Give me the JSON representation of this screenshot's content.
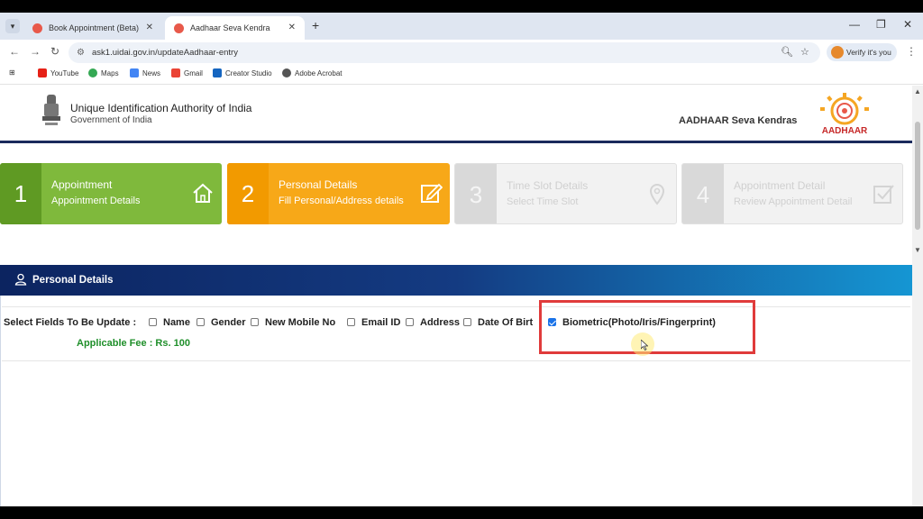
{
  "browser": {
    "tabs": [
      {
        "title": "Book Appointment (Beta)",
        "active": false
      },
      {
        "title": "Aadhaar Seva Kendra",
        "active": true
      }
    ],
    "url": "ask1.uidai.gov.in/updateAadhaar-entry",
    "profile_label": "Verify it's you",
    "bookmarks": [
      "YouTube",
      "Maps",
      "News",
      "Gmail",
      "Creator Studio",
      "Adobe Acrobat"
    ]
  },
  "header": {
    "org_name": "Unique Identification Authority of India",
    "org_sub": "Government of India",
    "seva_title": "AADHAAR Seva Kendras",
    "logo_text": "AADHAAR"
  },
  "steps": [
    {
      "num": "1",
      "title": "Appointment",
      "subtitle": "Appointment Details",
      "icon": "home-icon",
      "state": "done"
    },
    {
      "num": "2",
      "title": "Personal Details",
      "subtitle": "Fill Personal/Address details",
      "icon": "edit-icon",
      "state": "current"
    },
    {
      "num": "3",
      "title": "Time Slot Details",
      "subtitle": "Select Time Slot",
      "icon": "location-pin-icon",
      "state": "disabled"
    },
    {
      "num": "4",
      "title": "Appointment Detail",
      "subtitle": "Review Appointment Detail",
      "icon": "checkbox-icon",
      "state": "disabled"
    }
  ],
  "panel": {
    "title": "Personal Details",
    "select_label": "Select Fields To Be Update :",
    "fields": [
      {
        "label": "Name",
        "checked": false
      },
      {
        "label": "Gender",
        "checked": false
      },
      {
        "label": "New Mobile No",
        "checked": false
      },
      {
        "label": "Email ID",
        "checked": false
      },
      {
        "label": "Address",
        "checked": false
      },
      {
        "label": "Date Of Birt",
        "checked": false
      },
      {
        "label": "Biometric(Photo/Iris/Fingerprint)",
        "checked": true
      }
    ],
    "fee": "Applicable Fee : Rs. 100"
  },
  "colors": {
    "step_done": "#7fb93c",
    "step_current": "#f7a818",
    "panel_header": "#0c2460",
    "fee_text": "#1f8f2a",
    "highlight": "#e03b3b"
  }
}
